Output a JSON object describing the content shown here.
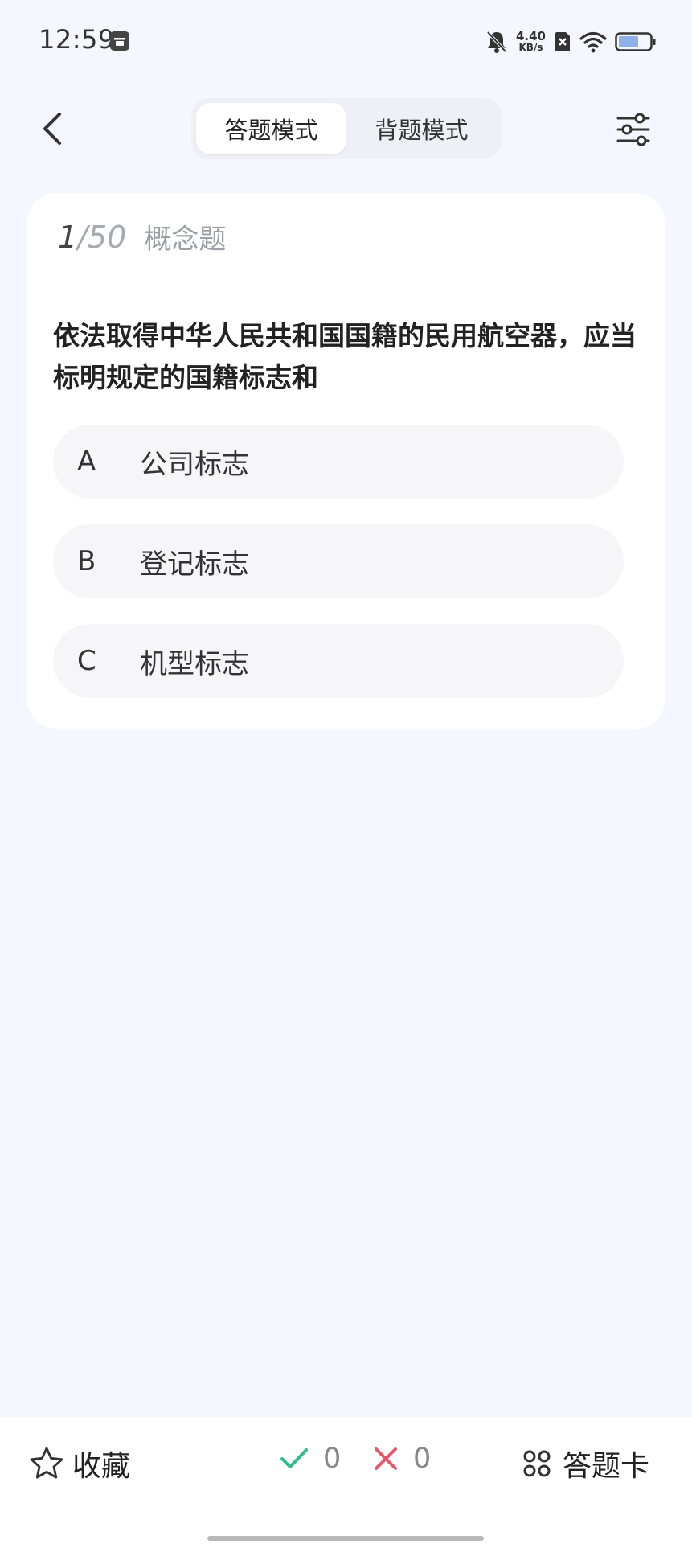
{
  "status_bar": {
    "time": "12:59",
    "net_speed_value": "4.40",
    "net_speed_unit": "KB/s"
  },
  "nav": {
    "tabs": [
      {
        "label": "答题模式",
        "active": true
      },
      {
        "label": "背题模式",
        "active": false
      }
    ]
  },
  "question": {
    "current": "1",
    "total": "/50",
    "type": "概念题",
    "text": "依法取得中华人民共和国国籍的民用航空器，应当标明规定的国籍标志和",
    "options": [
      {
        "letter": "A",
        "text": "公司标志"
      },
      {
        "letter": "B",
        "text": "登记标志"
      },
      {
        "letter": "C",
        "text": "机型标志"
      }
    ]
  },
  "bottom_bar": {
    "favorite_label": "收藏",
    "correct_count": "0",
    "wrong_count": "0",
    "answer_card_label": "答题卡"
  },
  "colors": {
    "background": "#f4f7fe",
    "correct": "#2fbf8a",
    "wrong": "#e8566c"
  }
}
